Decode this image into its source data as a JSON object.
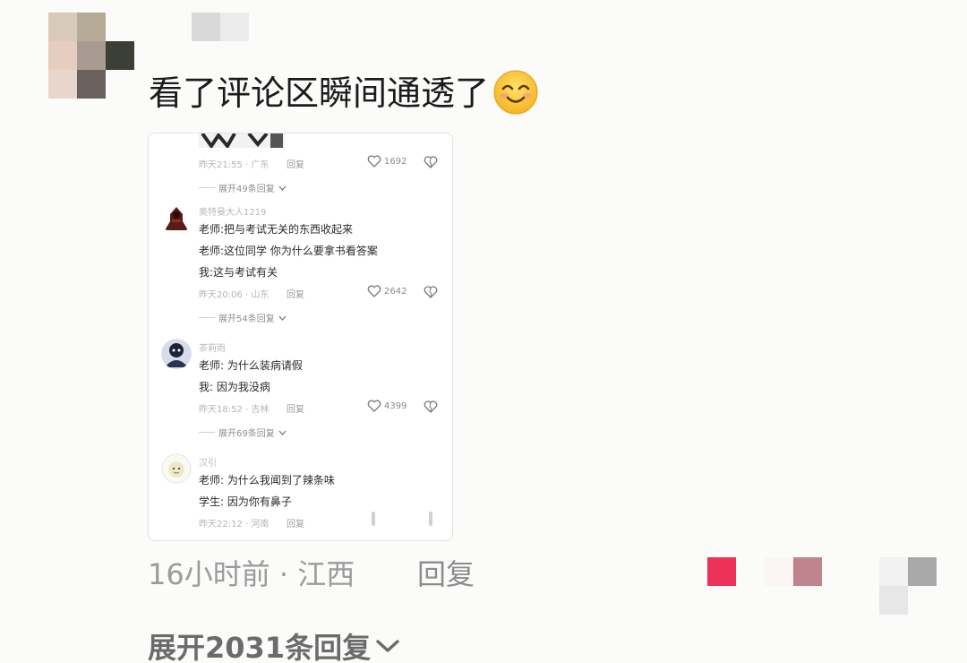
{
  "comment": {
    "text": "看了评论区瞬间通透了",
    "emoji_icon": "smiling-face-icon",
    "time_location": "16小时前 · 江西",
    "reply_label": "回复",
    "expand_label": "展开2031条回复"
  },
  "screenshot": {
    "top_meta": "昨天21:55 · 广东",
    "top_reply": "回复",
    "top_likes": "1692",
    "top_expand": "展开49条回复",
    "comments": [
      {
        "user": "奥特曼大人1219",
        "lines": [
          "老师:把与考试无关的东西收起来",
          "老师:这位同学 你为什么要拿书看答案",
          "我:这与考试有关"
        ],
        "meta": "昨天20:06 · 山东",
        "reply": "回复",
        "likes": "2642",
        "expand": "展开54条回复"
      },
      {
        "user": "茶莉雨",
        "lines": [
          "老师: 为什么装病请假",
          "我: 因为我没病"
        ],
        "meta": "昨天18:52 · 吉林",
        "reply": "回复",
        "likes": "4399",
        "expand": "展开69条回复"
      },
      {
        "user": "汉引",
        "lines": [
          "老师: 为什么我闻到了辣条味",
          "学生: 因为你有鼻子"
        ],
        "meta": "昨天22:12 · 河南",
        "reply": "回复"
      }
    ]
  },
  "colors": {
    "background": "#fbfbf9",
    "text_main": "#1b1b1b",
    "text_meta": "#9b9b9b",
    "redact_red": "#ee3257",
    "redact_mauve": "#c0848f"
  }
}
